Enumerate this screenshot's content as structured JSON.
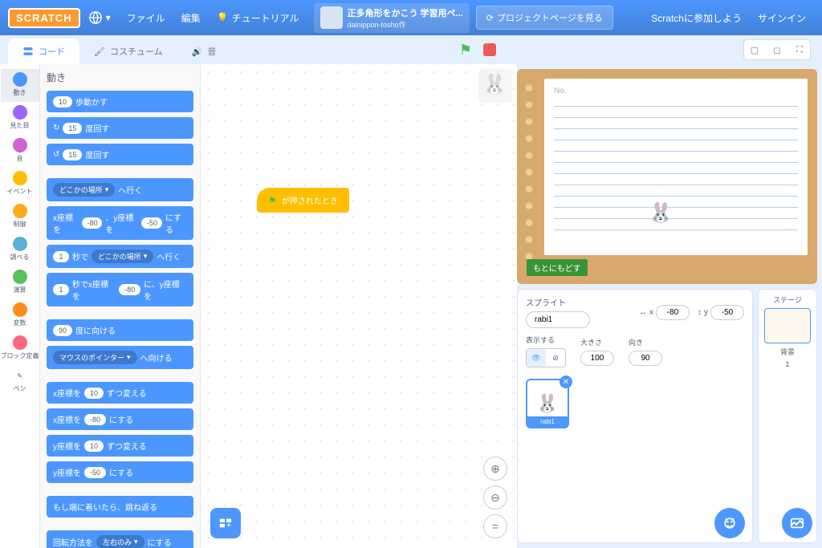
{
  "menu": {
    "logo": "SCRATCH",
    "file": "ファイル",
    "edit": "編集",
    "tutorials": "チュートリアル",
    "project_title": "正多角形をかこう 学習用ペ...",
    "project_author": "dainippon-tosho作",
    "see_project_page": "プロジェクトページを見る",
    "join": "Scratchに参加しよう",
    "signin": "サインイン"
  },
  "tabs": {
    "code": "コード",
    "costumes": "コスチューム",
    "sounds": "音"
  },
  "categories": [
    {
      "name": "動き",
      "color": "#4c97ff"
    },
    {
      "name": "見た目",
      "color": "#9966ff"
    },
    {
      "name": "音",
      "color": "#cf63cf"
    },
    {
      "name": "イベント",
      "color": "#ffbf00"
    },
    {
      "name": "制御",
      "color": "#ffab19"
    },
    {
      "name": "調べる",
      "color": "#5cb1d6"
    },
    {
      "name": "演算",
      "color": "#59c059"
    },
    {
      "name": "変数",
      "color": "#ff8c1a"
    },
    {
      "name": "ブロック定義",
      "color": "#ff6680"
    },
    {
      "name": "ペン",
      "color": "#0fbd8c"
    }
  ],
  "palette": {
    "header": "動き",
    "blocks": {
      "move_steps": {
        "val": "10",
        "suffix": "歩動かす"
      },
      "turn_cw": {
        "val": "15",
        "suffix": "度回す"
      },
      "turn_ccw": {
        "val": "15",
        "suffix": "度回す"
      },
      "goto": {
        "dropdown": "どこかの場所",
        "suffix": "へ行く"
      },
      "goto_xy": {
        "prefix": "x座標を",
        "x": "-80",
        "mid": "、y座標を",
        "y": "-50",
        "suffix": "にする"
      },
      "glide_to": {
        "sec": "1",
        "sec_suffix": "秒で",
        "dropdown": "どこかの場所",
        "suffix": "へ行く"
      },
      "glide_xy": {
        "sec": "1",
        "sec_suffix": "秒でx座標を",
        "x": "-80",
        "mid": "に、y座標を"
      },
      "point_dir": {
        "val": "90",
        "suffix": "度に向ける"
      },
      "point_towards": {
        "dropdown": "マウスのポインター",
        "suffix": "へ向ける"
      },
      "change_x": {
        "prefix": "x座標を",
        "val": "10",
        "suffix": "ずつ変える"
      },
      "set_x": {
        "prefix": "x座標を",
        "val": "-80",
        "suffix": "にする"
      },
      "change_y": {
        "prefix": "y座標を",
        "val": "10",
        "suffix": "ずつ変える"
      },
      "set_y": {
        "prefix": "y座標を",
        "val": "-50",
        "suffix": "にする"
      },
      "bounce": "もし端に着いたら、跳ね返る",
      "rotation_style": {
        "prefix": "回転方法を",
        "dropdown": "左右のみ",
        "suffix": "にする"
      }
    }
  },
  "workspace": {
    "when_flag": "が押されたとき"
  },
  "stage": {
    "paper_no": "No.",
    "reset": "もとにもどす"
  },
  "sprite_info": {
    "label": "スプライト",
    "name": "rabi1",
    "x_label": "x",
    "x": "-80",
    "y_label": "y",
    "y": "-50",
    "show_label": "表示する",
    "size_label": "大きさ",
    "size": "100",
    "direction_label": "向き",
    "direction": "90"
  },
  "sprite_card": {
    "name": "rabi1"
  },
  "stage_pane": {
    "label": "ステージ",
    "backdrops_label": "背景",
    "count": "1"
  }
}
